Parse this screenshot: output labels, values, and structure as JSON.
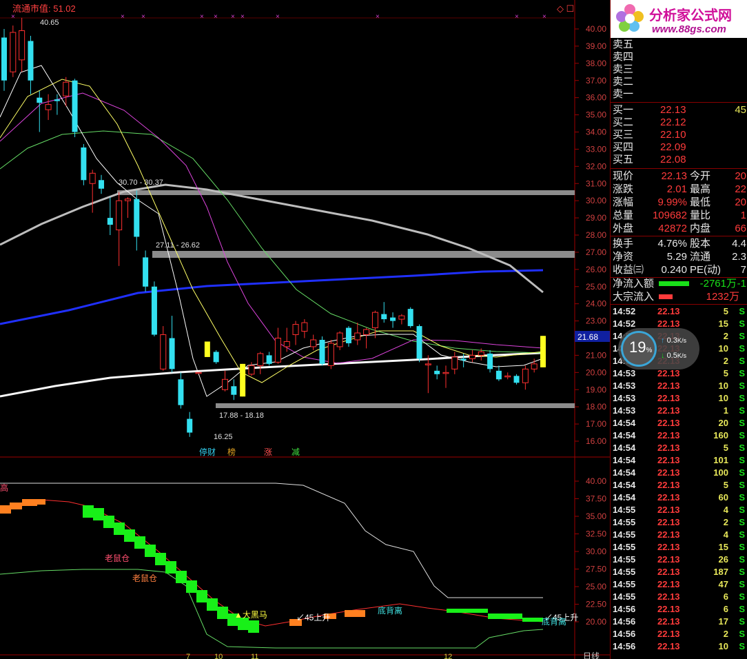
{
  "top_bar": {
    "title": "流通市值: 51.02",
    "markers": [
      "×",
      "×",
      "×",
      "×",
      "×",
      "×",
      "×",
      "×",
      "×",
      "×",
      "×"
    ],
    "corner_icons": "◇ ☐"
  },
  "main_chart": {
    "y_ticks": [
      "40.00",
      "39.00",
      "38.00",
      "37.00",
      "36.00",
      "35.00",
      "34.00",
      "33.00",
      "32.00",
      "31.00",
      "30.00",
      "29.00",
      "28.00",
      "27.00",
      "26.00",
      "25.00",
      "24.00",
      "23.00",
      "22.00",
      "21.00",
      "20.00",
      "19.00",
      "18.00",
      "17.00",
      "16.00"
    ],
    "current_price_tag": "21.68",
    "annotations": {
      "high": "40.65",
      "low": "16.25",
      "zone_top": "30.70 - 30.37",
      "zone_mid": "27.11 - 26.62",
      "zone_bottom": "17.88 - 18.18"
    },
    "event_labels": [
      "停财",
      "榜",
      "涨",
      "减"
    ],
    "colors": {
      "up": "#ff3030",
      "down": "#33e0f0",
      "ma5": "#ffffff",
      "ma10": "#ffff66",
      "ma20": "#e040e0",
      "ma30": "#66ee66",
      "ma60": "#c8c8c8",
      "ma120": "#2040ff",
      "ma250": "#ffffff"
    }
  },
  "sub_chart": {
    "y_ticks": [
      "40.00",
      "37.50",
      "35.00",
      "32.50",
      "30.00",
      "27.50",
      "25.00",
      "22.50",
      "20.00"
    ],
    "labels": {
      "rat1": "老鼠仓",
      "rat2": "老鼠仓",
      "horse": "▲大黑马",
      "rise1": "↙45上升",
      "div1": "底背离",
      "rise2": "↙45上升",
      "div2": "底背离",
      "corner": "高"
    },
    "date_ticks": [
      "7",
      "10",
      "11",
      "12"
    ],
    "period": "日线"
  },
  "right_panel": {
    "logo": {
      "title": "分析家公式网",
      "url": "www.88gs.com"
    },
    "asks": [
      {
        "label": "卖五"
      },
      {
        "label": "卖四"
      },
      {
        "label": "卖三"
      },
      {
        "label": "卖二"
      },
      {
        "label": "卖一"
      }
    ],
    "bids": [
      {
        "label": "买一",
        "price": "22.13",
        "vol": "45"
      },
      {
        "label": "买二",
        "price": "22.12",
        "vol": ""
      },
      {
        "label": "买三",
        "price": "22.10",
        "vol": ""
      },
      {
        "label": "买四",
        "price": "22.09",
        "vol": ""
      },
      {
        "label": "买五",
        "price": "22.08",
        "vol": ""
      }
    ],
    "quote": [
      {
        "l1": "现价",
        "v1": "22.13",
        "l2": "今开",
        "v2": "20"
      },
      {
        "l1": "涨跌",
        "v1": "2.01",
        "l2": "最高",
        "v2": "22"
      },
      {
        "l1": "涨幅",
        "v1": "9.99%",
        "l2": "最低",
        "v2": "20"
      },
      {
        "l1": "总量",
        "v1": "109682",
        "l2": "量比",
        "v2": "1"
      },
      {
        "l1": "外盘",
        "v1": "42872",
        "l2": "内盘",
        "v2": "66"
      }
    ],
    "fund": [
      {
        "l1": "换手",
        "v1": "4.76%",
        "l2": "股本",
        "v2": "4.4"
      },
      {
        "l1": "净资",
        "v1": "5.29",
        "l2": "流通",
        "v2": "2.3"
      },
      {
        "l1": "收益㈢",
        "v1": "0.240",
        "l2": "PE(动)",
        "v2": "7"
      }
    ],
    "flows": [
      {
        "label": "净流入额",
        "value": "-2761万",
        "tail": "-1",
        "bar": "#19e019"
      },
      {
        "label": "大宗流入",
        "value": "1232万",
        "tail": "",
        "bar": "#ff3b3b"
      }
    ],
    "ticks": [
      {
        "t": "14:52",
        "p": "22.13",
        "v": "5",
        "s": "S"
      },
      {
        "t": "14:52",
        "p": "22.13",
        "v": "15",
        "s": "S"
      },
      {
        "t": "14:52",
        "p": "22.13",
        "v": "2",
        "s": "S"
      },
      {
        "t": "14:53",
        "p": "22.13",
        "v": "10",
        "s": "S"
      },
      {
        "t": "14:53",
        "p": "22.13",
        "v": "2",
        "s": "S"
      },
      {
        "t": "14:53",
        "p": "22.13",
        "v": "5",
        "s": "S"
      },
      {
        "t": "14:53",
        "p": "22.13",
        "v": "10",
        "s": "S"
      },
      {
        "t": "14:53",
        "p": "22.13",
        "v": "10",
        "s": "S"
      },
      {
        "t": "14:53",
        "p": "22.13",
        "v": "1",
        "s": "S"
      },
      {
        "t": "14:54",
        "p": "22.13",
        "v": "20",
        "s": "S"
      },
      {
        "t": "14:54",
        "p": "22.13",
        "v": "160",
        "s": "S"
      },
      {
        "t": "14:54",
        "p": "22.13",
        "v": "5",
        "s": "S"
      },
      {
        "t": "14:54",
        "p": "22.13",
        "v": "101",
        "s": "S"
      },
      {
        "t": "14:54",
        "p": "22.13",
        "v": "100",
        "s": "S"
      },
      {
        "t": "14:54",
        "p": "22.13",
        "v": "5",
        "s": "S"
      },
      {
        "t": "14:54",
        "p": "22.13",
        "v": "60",
        "s": "S"
      },
      {
        "t": "14:55",
        "p": "22.13",
        "v": "4",
        "s": "S"
      },
      {
        "t": "14:55",
        "p": "22.13",
        "v": "2",
        "s": "S"
      },
      {
        "t": "14:55",
        "p": "22.13",
        "v": "4",
        "s": "S"
      },
      {
        "t": "14:55",
        "p": "22.13",
        "v": "15",
        "s": "S"
      },
      {
        "t": "14:55",
        "p": "22.13",
        "v": "26",
        "s": "S"
      },
      {
        "t": "14:55",
        "p": "22.13",
        "v": "187",
        "s": "S"
      },
      {
        "t": "14:55",
        "p": "22.13",
        "v": "47",
        "s": "S"
      },
      {
        "t": "14:55",
        "p": "22.13",
        "v": "6",
        "s": "S"
      },
      {
        "t": "14:56",
        "p": "22.13",
        "v": "6",
        "s": "S"
      },
      {
        "t": "14:56",
        "p": "22.13",
        "v": "17",
        "s": "S"
      },
      {
        "t": "14:56",
        "p": "22.13",
        "v": "2",
        "s": "S"
      },
      {
        "t": "14:56",
        "p": "22.13",
        "v": "10",
        "s": "S"
      }
    ],
    "speed": {
      "percent": "19",
      "pct_sign": "%",
      "up": "0.3",
      "down": "0.5",
      "unit": "K/s"
    }
  },
  "candles": [
    {
      "o": 39.5,
      "c": 37.0,
      "h": 40.0,
      "l": 36.4
    },
    {
      "o": 37.5,
      "c": 39.8,
      "h": 40.2,
      "l": 37.2
    },
    {
      "o": 38.2,
      "c": 39.9,
      "h": 40.65,
      "l": 37.5
    },
    {
      "o": 39.3,
      "c": 37.0,
      "h": 39.6,
      "l": 36.2
    },
    {
      "o": 36.0,
      "c": 35.7,
      "h": 36.4,
      "l": 34.0
    },
    {
      "o": 35.3,
      "c": 35.6,
      "h": 36.2,
      "l": 34.7
    },
    {
      "o": 35.9,
      "c": 35.8,
      "h": 36.2,
      "l": 35.0
    },
    {
      "o": 36.1,
      "c": 36.9,
      "h": 37.2,
      "l": 35.5
    },
    {
      "o": 37.0,
      "c": 34.0,
      "h": 37.1,
      "l": 33.7
    },
    {
      "o": 33.1,
      "c": 31.2,
      "h": 33.3,
      "l": 30.9
    },
    {
      "o": 31.0,
      "c": 31.6,
      "h": 31.8,
      "l": 29.3
    },
    {
      "o": 31.2,
      "c": 30.7,
      "h": 31.5,
      "l": 30.4
    },
    {
      "o": 29.0,
      "c": 28.6,
      "h": 30.2,
      "l": 28.0
    },
    {
      "o": 28.3,
      "c": 30.0,
      "h": 30.5,
      "l": 26.2
    },
    {
      "o": 30.0,
      "c": 30.1,
      "h": 30.2,
      "l": 29.0
    },
    {
      "o": 30.1,
      "c": 27.9,
      "h": 30.6,
      "l": 27.1
    },
    {
      "o": 26.7,
      "c": 25.0,
      "h": 27.1,
      "l": 24.7
    },
    {
      "o": 25.0,
      "c": 22.2,
      "h": 25.3,
      "l": 22.1
    },
    {
      "o": 20.2,
      "c": 22.2,
      "h": 22.7,
      "l": 20.1
    },
    {
      "o": 22.0,
      "c": 20.2,
      "h": 23.3,
      "l": 20.0
    },
    {
      "o": 19.6,
      "c": 18.1,
      "h": 20.0,
      "l": 17.9
    },
    {
      "o": 17.3,
      "c": 16.5,
      "h": 17.7,
      "l": 16.25
    },
    {
      "o": 20.0,
      "c": 20.0,
      "h": 20.0,
      "l": 20.0
    },
    {
      "o": 21.8,
      "c": 20.9,
      "h": 21.8,
      "l": 20.9
    },
    {
      "o": 21.2,
      "c": 20.6,
      "h": 21.3,
      "l": 20.5
    },
    {
      "o": 19.0,
      "c": 19.6,
      "h": 20.1,
      "l": 18.9
    },
    {
      "o": 19.2,
      "c": 18.7,
      "h": 19.6,
      "l": 18.4
    },
    {
      "o": 18.6,
      "c": 20.5,
      "h": 20.5,
      "l": 18.6
    },
    {
      "o": 19.9,
      "c": 20.4,
      "h": 20.6,
      "l": 19.8
    },
    {
      "o": 20.4,
      "c": 21.1,
      "h": 21.2,
      "l": 19.9
    },
    {
      "o": 21.0,
      "c": 20.5,
      "h": 21.2,
      "l": 20.4
    },
    {
      "o": 20.6,
      "c": 22.0,
      "h": 22.6,
      "l": 20.5
    },
    {
      "o": 21.5,
      "c": 21.8,
      "h": 22.6,
      "l": 21.2
    },
    {
      "o": 22.2,
      "c": 22.8,
      "h": 23.0,
      "l": 21.6
    },
    {
      "o": 22.4,
      "c": 22.9,
      "h": 23.1,
      "l": 22.0
    },
    {
      "o": 21.5,
      "c": 21.9,
      "h": 22.2,
      "l": 21.3
    },
    {
      "o": 21.9,
      "c": 20.5,
      "h": 22.1,
      "l": 20.4
    },
    {
      "o": 20.4,
      "c": 21.7,
      "h": 21.9,
      "l": 20.2
    },
    {
      "o": 21.5,
      "c": 22.3,
      "h": 22.4,
      "l": 21.3
    },
    {
      "o": 22.6,
      "c": 21.7,
      "h": 22.7,
      "l": 21.5
    },
    {
      "o": 21.9,
      "c": 22.3,
      "h": 22.9,
      "l": 21.6
    },
    {
      "o": 22.2,
      "c": 22.5,
      "h": 22.6,
      "l": 21.4
    },
    {
      "o": 22.6,
      "c": 23.5,
      "h": 23.6,
      "l": 22.0
    },
    {
      "o": 23.4,
      "c": 23.1,
      "h": 24.1,
      "l": 22.9
    },
    {
      "o": 23.2,
      "c": 23.0,
      "h": 23.5,
      "l": 22.6
    },
    {
      "o": 23.1,
      "c": 23.3,
      "h": 23.4,
      "l": 22.8
    },
    {
      "o": 23.7,
      "c": 22.7,
      "h": 23.8,
      "l": 22.6
    },
    {
      "o": 22.7,
      "c": 20.8,
      "h": 22.8,
      "l": 20.6
    },
    {
      "o": 20.5,
      "c": 20.5,
      "h": 21.0,
      "l": 18.8
    },
    {
      "o": 20.1,
      "c": 19.9,
      "h": 20.4,
      "l": 19.6
    },
    {
      "o": 20.0,
      "c": 20.0,
      "h": 20.4,
      "l": 19.1
    },
    {
      "o": 20.2,
      "c": 20.9,
      "h": 21.2,
      "l": 19.9
    },
    {
      "o": 20.8,
      "c": 20.7,
      "h": 21.1,
      "l": 20.3
    },
    {
      "o": 20.8,
      "c": 21.0,
      "h": 21.3,
      "l": 20.6
    },
    {
      "o": 21.0,
      "c": 21.2,
      "h": 21.4,
      "l": 20.7
    },
    {
      "o": 21.1,
      "c": 20.2,
      "h": 21.3,
      "l": 20.0
    },
    {
      "o": 20.1,
      "c": 19.6,
      "h": 20.4,
      "l": 19.5
    },
    {
      "o": 19.8,
      "c": 19.8,
      "h": 20.0,
      "l": 19.6
    },
    {
      "o": 19.8,
      "c": 19.4,
      "h": 19.9,
      "l": 19.3
    },
    {
      "o": 19.4,
      "c": 20.2,
      "h": 20.4,
      "l": 19.0
    },
    {
      "o": 20.2,
      "c": 20.5,
      "h": 20.8,
      "l": 20.0
    },
    {
      "o": 20.3,
      "c": 22.13,
      "h": 22.13,
      "l": 20.3
    }
  ]
}
